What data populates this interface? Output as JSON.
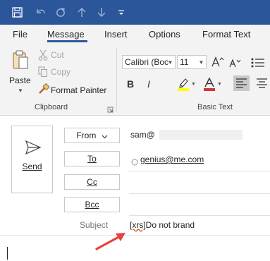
{
  "tabs": {
    "file": "File",
    "message": "Message",
    "insert": "Insert",
    "options": "Options",
    "format_text": "Format Text"
  },
  "clipboard": {
    "paste": "Paste",
    "cut": "Cut",
    "copy": "Copy",
    "format_painter": "Format Painter",
    "group_label": "Clipboard"
  },
  "basic_text": {
    "font": "Calibri (Boc",
    "size": "11",
    "bold": "B",
    "italic": "I",
    "group_label": "Basic Text"
  },
  "compose": {
    "send": "Send",
    "from_label": "From",
    "from_value": "sam@",
    "to_label": "To",
    "to_value": "genius@me.com",
    "cc_label": "Cc",
    "bcc_label": "Bcc",
    "subject_label": "Subject",
    "subject_prefix": "[xrs]",
    "subject_text": "Do not brand"
  },
  "colors": {
    "title_bar": "#2b579a",
    "ribbon": "#f3f3f3",
    "highlight": "#ffff00",
    "font_color": "#d13438",
    "annotation_arrow": "#e8413c"
  },
  "icons": [
    "save-icon",
    "undo-icon",
    "redo-icon",
    "up-icon",
    "down-icon",
    "customize-icon",
    "paste-icon",
    "cut-icon",
    "copy-icon",
    "format-painter-icon",
    "send-icon",
    "dialog-launcher-icon",
    "highlight-icon",
    "font-color-icon",
    "align-left-icon",
    "align-center-icon",
    "chevron-down-icon",
    "contact-status-icon",
    "annotation-arrow-icon"
  ]
}
